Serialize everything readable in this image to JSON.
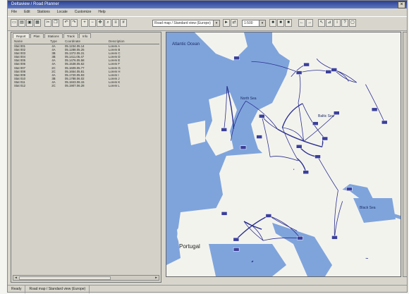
{
  "window": {
    "title": "Deltaview / Road Planner"
  },
  "menu": [
    "File",
    "Edit",
    "Stations",
    "Locate",
    "Customize",
    "Help"
  ],
  "toolbar": {
    "buttons": [
      "new",
      "open",
      "save",
      "print",
      "cut",
      "copy",
      "paste",
      "undo",
      "zoom-in",
      "zoom-out",
      "pan",
      "find"
    ],
    "route_dropdown": "Road map / Standard view (Europe)",
    "scale_dropdown": "1:500"
  },
  "left_panel": {
    "tabs": [
      "Report",
      "Plan",
      "Stations",
      "Track",
      "Info"
    ],
    "columns": [
      "Name",
      "Type",
      "Coordinate",
      "Description"
    ],
    "rows": [
      [
        "Stat 001",
        "4A",
        "05.1234.05.14",
        "Lorem A"
      ],
      [
        "Stat 002",
        "4A",
        "05.1288.05.25",
        "Lorem B"
      ],
      [
        "Stat 003",
        "3B",
        "05.1372.05.31",
        "Lorem C"
      ],
      [
        "Stat 004",
        "3B",
        "05.1411.05.47",
        "Lorem D"
      ],
      [
        "Stat 005",
        "4A",
        "05.1476.05.58",
        "Lorem E"
      ],
      [
        "Stat 006",
        "4A",
        "05.1538.05.62",
        "Lorem F"
      ],
      [
        "Stat 007",
        "2C",
        "05.1609.05.77",
        "Lorem G"
      ],
      [
        "Stat 008",
        "2C",
        "05.1654.05.81",
        "Lorem H"
      ],
      [
        "Stat 009",
        "4A",
        "05.1720.05.93",
        "Lorem I"
      ],
      [
        "Stat 010",
        "3B",
        "05.1788.06.02",
        "Lorem J"
      ],
      [
        "Stat 011",
        "4A",
        "05.1843.06.15",
        "Lorem K"
      ],
      [
        "Stat 012",
        "2C",
        "05.1907.06.28",
        "Lorem L"
      ]
    ]
  },
  "map": {
    "labels": [
      "Atlantic Ocean",
      "North Sea",
      "Baltic Sea",
      "Portugal",
      "Black Sea"
    ],
    "water_color": "#7fa4dc",
    "land_color": "#f3f3ee",
    "road_color": "#2a2f8f"
  },
  "status": {
    "left": "Ready",
    "middle": "Road map / Standard view (Europe)"
  }
}
